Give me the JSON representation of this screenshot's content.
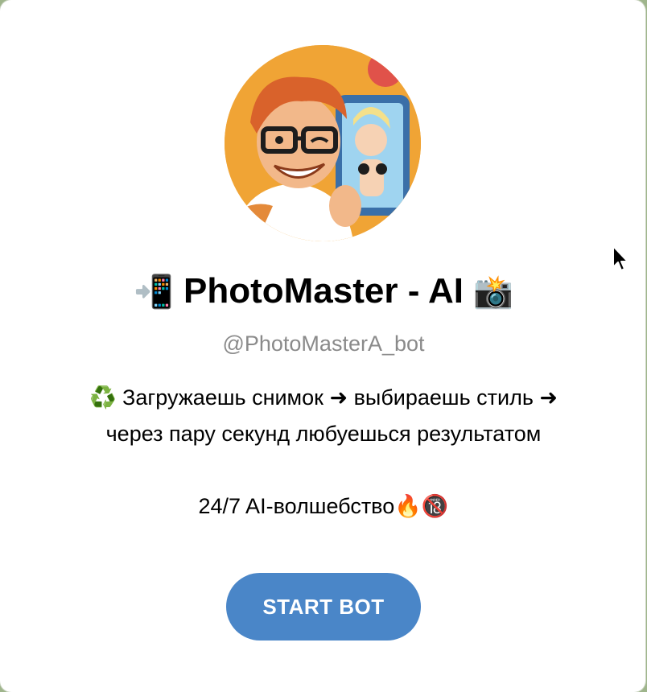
{
  "bot": {
    "title_prefix_emoji": "📲",
    "title": "PhotoMaster - AI",
    "title_suffix_emoji": "📸",
    "username": "@PhotoMasterA_bot",
    "description_lines": [
      "♻️ Загружаешь снимок ➜ выбираешь стиль ➜",
      "через пару секунд любуешься результатом",
      "24/7 AI-волшебство🔥🔞"
    ]
  },
  "actions": {
    "start_label": "START BOT"
  },
  "icons": {
    "avatar": "bot-avatar-cartoon-selfie",
    "cursor": "mouse-pointer-icon"
  },
  "colors": {
    "button": "#4a86c8",
    "username": "#8a8a8a",
    "avatar_background": "#f0a435"
  }
}
